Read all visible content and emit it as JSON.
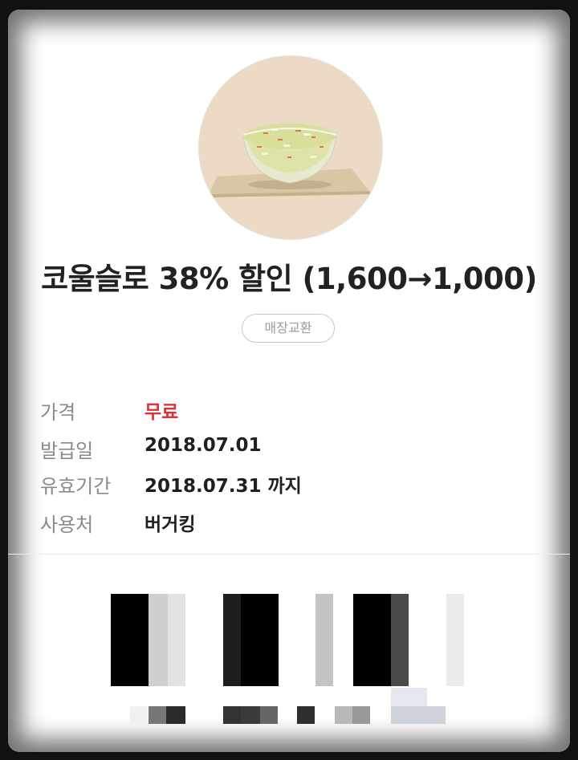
{
  "coupon": {
    "title": "코울슬로 38% 할인 (1,600→1,000)",
    "badge": "매장교환",
    "image": "coleslaw-bowl",
    "colors": {
      "price": "#e0303a",
      "image_bg": "#ecdac4"
    }
  },
  "details": [
    {
      "label": "가격",
      "value": "무료"
    },
    {
      "label": "발급일",
      "value": "2018.07.01"
    },
    {
      "label": "유효기간",
      "value": "2018.07.31 까지"
    },
    {
      "label": "사용처",
      "value": "버거킹"
    }
  ],
  "barcode": {
    "state": "obscured"
  }
}
